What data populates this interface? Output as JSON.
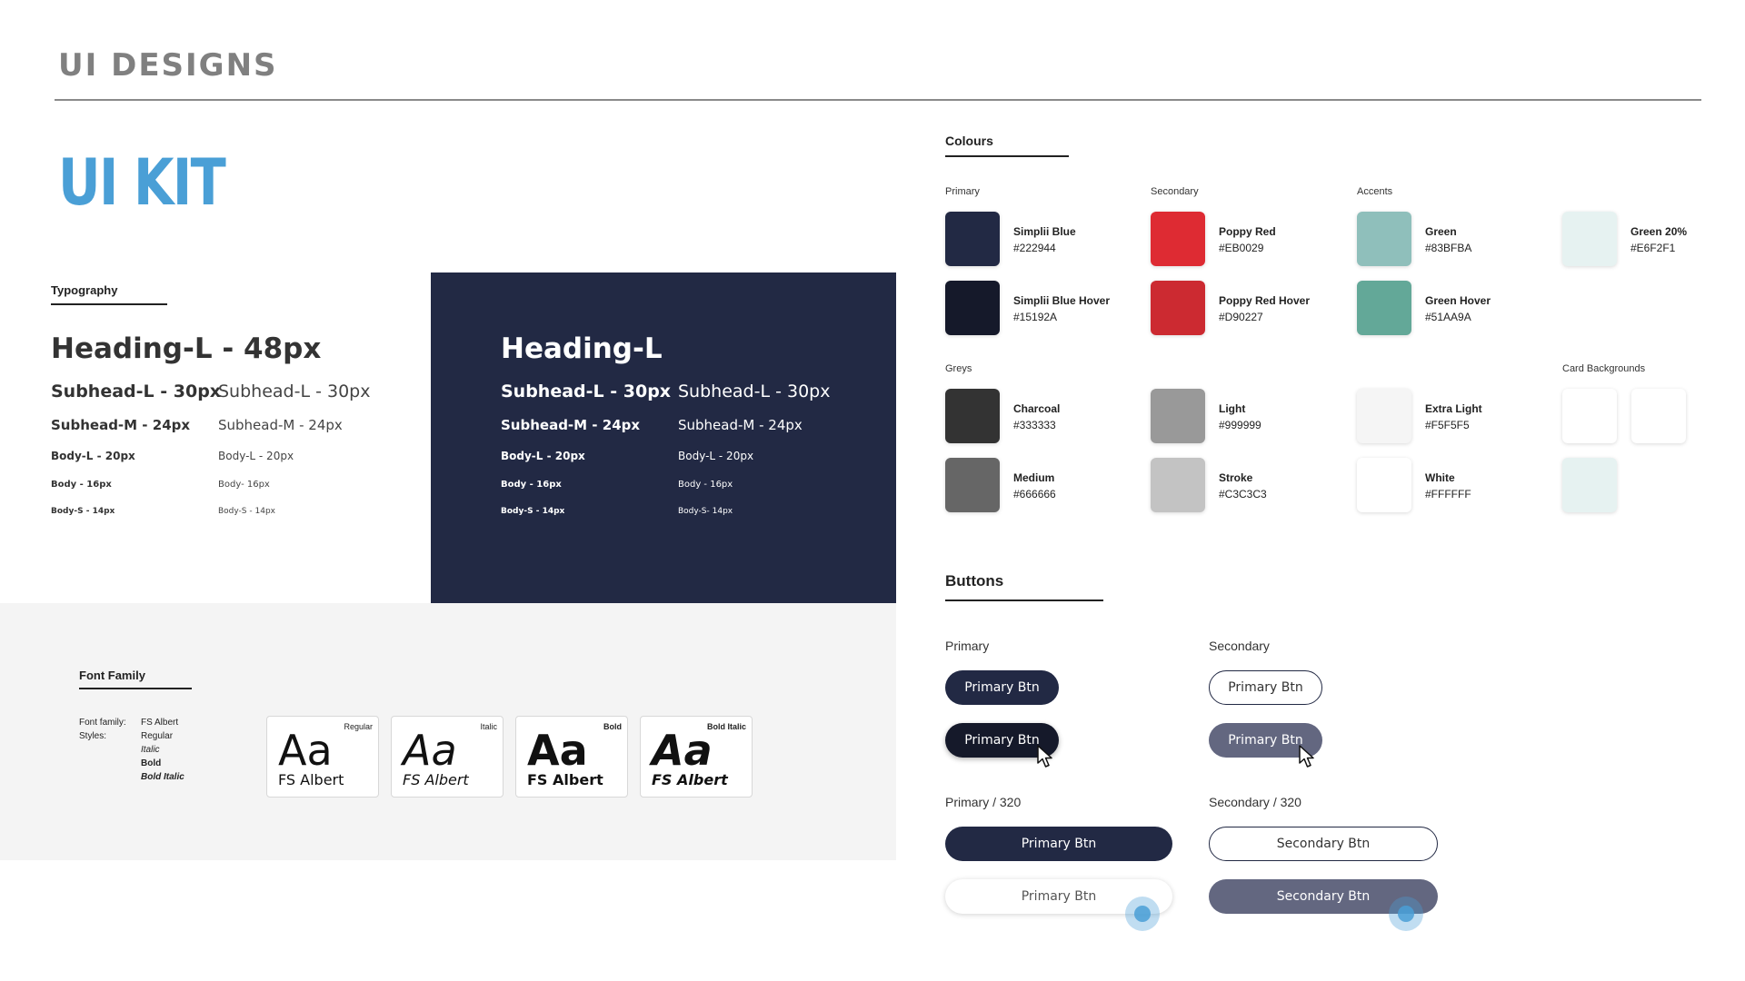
{
  "header": {
    "title": "UI DESIGNS",
    "kit_title": "UI KIT"
  },
  "typography": {
    "label": "Typography",
    "light": {
      "heading": "Heading-L - 48px",
      "bold": [
        "Subhead-L - 30px",
        "Subhead-M - 24px",
        "Body-L - 20px",
        "Body - 16px",
        "Body-S - 14px"
      ],
      "regular": [
        "Subhead-L - 30px",
        "Subhead-M - 24px",
        "Body-L - 20px",
        "Body- 16px",
        "Body-S - 14px"
      ]
    },
    "dark": {
      "heading": "Heading-L",
      "bold": [
        "Subhead-L  - 30px",
        "Subhead-M - 24px",
        "Body-L  - 20px",
        "Body - 16px",
        "Body-S - 14px"
      ],
      "regular": [
        "Subhead-L  - 30px",
        "Subhead-M  - 24px",
        "Body-L  - 20px",
        "Body - 16px",
        "Body-S- 14px"
      ]
    }
  },
  "font_family": {
    "label": "Font Family",
    "family_key": "Font family:",
    "family_value": "FS Albert",
    "styles_key": "Styles:",
    "styles": [
      "Regular",
      "Italic",
      "Bold",
      "Bold Italic"
    ],
    "cards": [
      {
        "tag": "Regular",
        "sample": "Aa",
        "name": "FS Albert"
      },
      {
        "tag": "Italic",
        "sample": "Aa",
        "name": "FS Albert"
      },
      {
        "tag": "Bold",
        "sample": "Aa",
        "name": "FS Albert"
      },
      {
        "tag": "Bold Italic",
        "sample": "Aa",
        "name": "FS Albert"
      }
    ]
  },
  "colours": {
    "label": "Colours",
    "groups": {
      "primary": "Primary",
      "secondary": "Secondary",
      "accents": "Accents",
      "greys": "Greys",
      "card_bg": "Card Backgrounds"
    },
    "swatches": {
      "simplii_blue": {
        "name": "Simplii Blue",
        "hex": "#222944",
        "color": "#222944"
      },
      "simplii_blue_hover": {
        "name": "Simplii Blue Hover",
        "hex": "#15192A",
        "color": "#15192A"
      },
      "poppy_red": {
        "name": "Poppy Red",
        "hex": "#EB0029",
        "color": "#DE2B33"
      },
      "poppy_red_hover": {
        "name": "Poppy Red Hover",
        "hex": "#D90227",
        "color": "#CC2A31"
      },
      "green": {
        "name": "Green",
        "hex": "#83BFBA",
        "color": "#8FBFBB"
      },
      "green_hover": {
        "name": "Green Hover",
        "hex": "#51AA9A",
        "color": "#63A898"
      },
      "green_20": {
        "name": "Green 20%",
        "hex": "#E6F2F1",
        "color": "#E6F2F1"
      },
      "charcoal": {
        "name": "Charcoal",
        "hex": "#333333",
        "color": "#333333"
      },
      "medium": {
        "name": "Medium",
        "hex": "#666666",
        "color": "#666666"
      },
      "light": {
        "name": "Light",
        "hex": "#999999",
        "color": "#999999"
      },
      "stroke": {
        "name": "Stroke",
        "hex": "#C3C3C3",
        "color": "#C3C3C3"
      },
      "extra_light": {
        "name": "Extra Light",
        "hex": "#F5F5F5",
        "color": "#F5F5F5"
      },
      "white": {
        "name": "White",
        "hex": "#FFFFFF",
        "color": "#FFFFFF"
      },
      "card_white_1": {
        "color": "#FFFFFF"
      },
      "card_white_2": {
        "color": "#FFFFFF"
      },
      "card_green": {
        "color": "#E6F2F1"
      }
    }
  },
  "buttons": {
    "label": "Buttons",
    "primary_label": "Primary",
    "secondary_label": "Secondary",
    "primary_320_label": "Primary / 320",
    "secondary_320_label": "Secondary / 320",
    "primary_btn": "Primary Btn",
    "primary_btn_hover": "Primary Btn",
    "secondary_btn": "Primary Btn",
    "secondary_btn_hover": "Primary Btn",
    "primary_320": "Primary Btn",
    "primary_320_pressed": "Primary Btn",
    "secondary_320": "Secondary Btn",
    "secondary_320_pressed": "Secondary Btn"
  }
}
